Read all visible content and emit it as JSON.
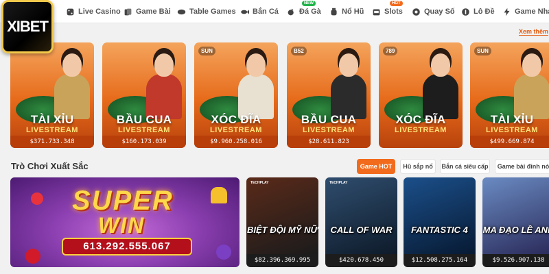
{
  "logo": {
    "text": "XIBET"
  },
  "nav": [
    {
      "label": "Live Casino",
      "icon": "dice-icon"
    },
    {
      "label": "Game Bài",
      "icon": "cards-icon"
    },
    {
      "label": "Table Games",
      "icon": "table-games-icon"
    },
    {
      "label": "Bắn Cá",
      "icon": "fish-icon"
    },
    {
      "label": "Đá Gà",
      "icon": "rooster-icon",
      "badge": "NEW"
    },
    {
      "label": "Nổ Hũ",
      "icon": "jar-icon"
    },
    {
      "label": "Slots",
      "icon": "slot-machine-icon",
      "badge": "HOT"
    },
    {
      "label": "Quay Số",
      "icon": "lottery-ball-icon"
    },
    {
      "label": "Lô Đề",
      "icon": "number-icon"
    },
    {
      "label": "Game Nhan",
      "icon": "bolt-icon"
    }
  ],
  "section_live": {
    "title_visible": "no",
    "see_all": "Xem thêm",
    "cards": [
      {
        "provider": "",
        "name": "TÀI XỈU",
        "sub": "LIVESTREAM",
        "jackpot": "$371.733.348",
        "dealer_color": "#c9a35a"
      },
      {
        "provider": "",
        "name": "BẦU CUA",
        "sub": "LIVESTREAM",
        "jackpot": "$160.173.039",
        "dealer_color": "#c0392b"
      },
      {
        "provider": "SUN",
        "name": "XÓC ĐĨA",
        "sub": "LIVESTREAM",
        "jackpot": "$9.960.258.016",
        "dealer_color": "#e8e0d0"
      },
      {
        "provider": "B52",
        "name": "BẦU CUA",
        "sub": "LIVESTREAM",
        "jackpot": "$28.611.823",
        "dealer_color": "#2b2b2b"
      },
      {
        "provider": "789",
        "name": "XÓC ĐĨA",
        "sub": "LIVESTREAM",
        "jackpot": "",
        "dealer_color": "#1d1d1d"
      },
      {
        "provider": "SUN",
        "name": "TÀI XỈU",
        "sub": "LIVESTREAM",
        "jackpot": "$499.669.874",
        "dealer_color": "#c9a35a"
      }
    ]
  },
  "section_featured": {
    "title": "Trò Chơi Xuất Sắc",
    "tabs": [
      "Game HOT",
      "Hũ sắp nổ",
      "Bắn cá siêu cấp",
      "Game bài đỉnh nóc"
    ],
    "super_win": {
      "line1": "SUPER",
      "line2": "WIN",
      "jackpot": "613.292.555.067"
    },
    "games": [
      {
        "provider": "TECHPLAY",
        "title": "BIỆT ĐỘI MỸ NỮ",
        "jackpot": "$82.396.369.995",
        "color1": "#5a2a1a",
        "color2": "#1b1b1b"
      },
      {
        "provider": "TECHPLAY",
        "title": "CALL OF WAR",
        "jackpot": "$420.678.450",
        "color1": "#2f4d6e",
        "color2": "#0e1b2a"
      },
      {
        "provider": "",
        "title": "FANTASTIC 4",
        "jackpot": "$12.508.275.164",
        "color1": "#1b4f8a",
        "color2": "#071a33"
      },
      {
        "provider": "",
        "title": "MA ĐẠO LỀ ANH",
        "jackpot": "$9.526.907.138",
        "color1": "#6a8bc2",
        "color2": "#2a2a5a"
      }
    ]
  }
}
